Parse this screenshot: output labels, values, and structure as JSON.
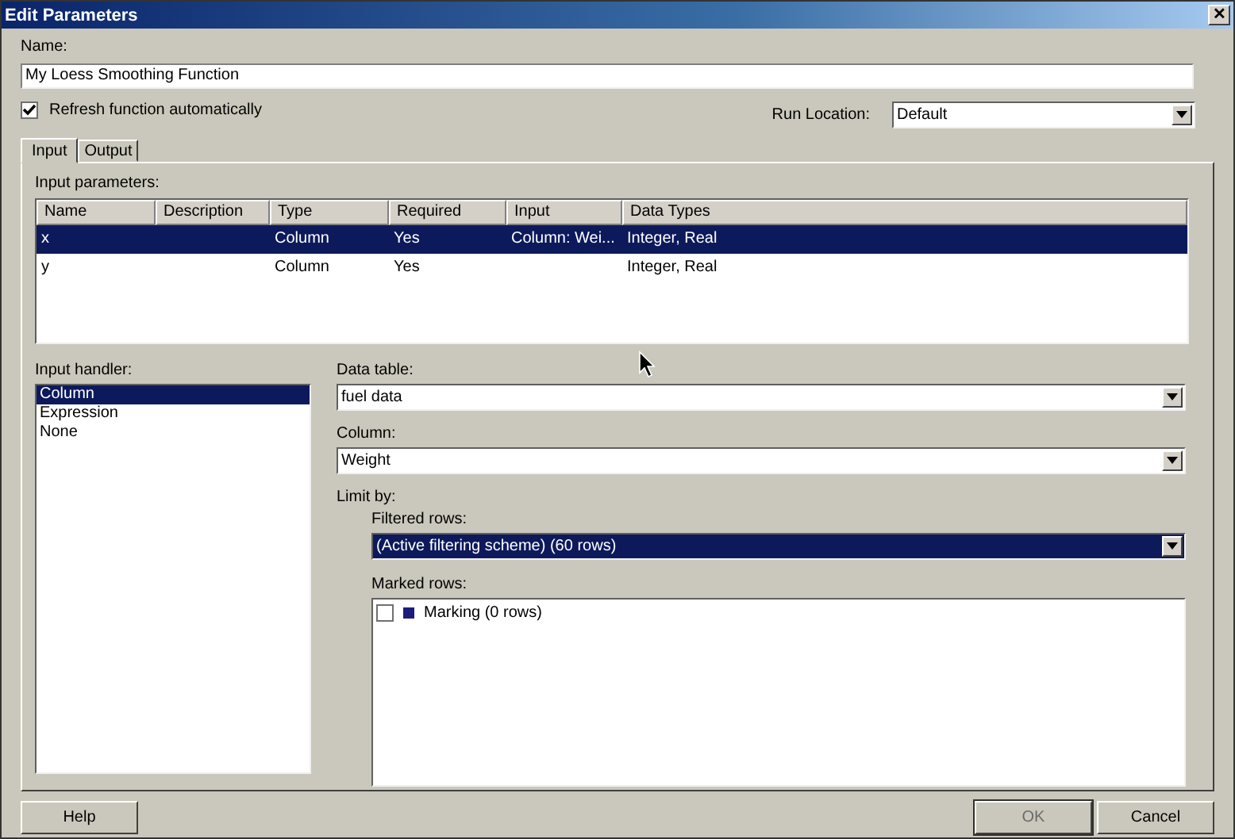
{
  "window": {
    "title": "Edit Parameters",
    "close": "✕"
  },
  "name": {
    "label": "Name:",
    "value": "My Loess Smoothing Function"
  },
  "refresh": {
    "label": "Refresh function automatically",
    "checked": true
  },
  "run_location": {
    "label": "Run Location:",
    "value": "Default"
  },
  "tabs": [
    {
      "label": "Input",
      "selected": true
    },
    {
      "label": "Output",
      "selected": false
    }
  ],
  "params": {
    "label": "Input parameters:",
    "columns": [
      "Name",
      "Description",
      "Type",
      "Required",
      "Input",
      "Data Types"
    ],
    "rows": [
      {
        "cells": [
          "x",
          "",
          "Column",
          "Yes",
          "Column: Wei...",
          "Integer, Real"
        ],
        "selected": true
      },
      {
        "cells": [
          "y",
          "",
          "Column",
          "Yes",
          "",
          "Integer, Real"
        ],
        "selected": false
      }
    ]
  },
  "handler": {
    "label": "Input handler:",
    "items": [
      {
        "label": "Column",
        "selected": true
      },
      {
        "label": "Expression",
        "selected": false
      },
      {
        "label": "None",
        "selected": false
      }
    ]
  },
  "data_table": {
    "label": "Data table:",
    "value": "fuel data"
  },
  "column": {
    "label": "Column:",
    "value": "Weight"
  },
  "limit_by": {
    "label": "Limit by:",
    "filtered": {
      "label": "Filtered rows:",
      "value": "(Active filtering scheme) (60 rows)",
      "focused": true
    },
    "marked": {
      "label": "Marked rows:",
      "items": [
        {
          "label": "Marking (0 rows)",
          "checked": false,
          "color": "#1c1c7c"
        }
      ]
    }
  },
  "buttons": [
    {
      "label": "Help",
      "disabled": false
    },
    {
      "label": "OK",
      "disabled": true
    },
    {
      "label": "Cancel",
      "disabled": false
    }
  ]
}
